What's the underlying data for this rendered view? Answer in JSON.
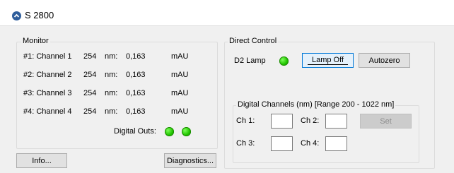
{
  "window": {
    "title": "S 2800",
    "icon": "collapse-chevron-icon"
  },
  "monitor": {
    "legend": "Monitor",
    "rows": [
      {
        "label": "#1: Channel 1",
        "wavelength": "254",
        "unit_nm": "nm:",
        "value": "0,163",
        "unit": "mAU"
      },
      {
        "label": "#2: Channel 2",
        "wavelength": "254",
        "unit_nm": "nm:",
        "value": "0,163",
        "unit": "mAU"
      },
      {
        "label": "#3: Channel 3",
        "wavelength": "254",
        "unit_nm": "nm:",
        "value": "0,163",
        "unit": "mAU"
      },
      {
        "label": "#4: Channel 4",
        "wavelength": "254",
        "unit_nm": "nm:",
        "value": "0,163",
        "unit": "mAU"
      }
    ],
    "digital_outs_label": "Digital Outs:"
  },
  "buttons": {
    "info": "Info...",
    "diagnostics": "Diagnostics..."
  },
  "direct_control": {
    "legend": "Direct Control",
    "d2_lamp_label": "D2 Lamp",
    "lamp_off": "Lamp Off",
    "autozero": "Autozero"
  },
  "digital_channels": {
    "legend": "Digital Channels (nm) [Range 200 - 1022 nm]",
    "ch1": "Ch 1:",
    "ch2": "Ch 2:",
    "ch3": "Ch 3:",
    "ch4": "Ch 4:",
    "ch1_value": "",
    "ch2_value": "",
    "ch3_value": "",
    "ch4_value": "",
    "set": "Set"
  },
  "colors": {
    "led_on": "#22c400",
    "title_icon": "#2f5e9c",
    "focus_border": "#0078d7"
  }
}
